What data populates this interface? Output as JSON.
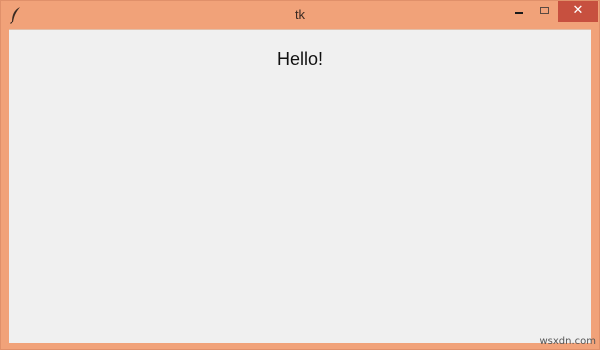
{
  "window": {
    "title": "tk",
    "frame_color": "#f1a279",
    "close_color": "#c7503f",
    "app_icon": "feather-icon",
    "controls": {
      "minimize_icon": "minimize-icon",
      "maximize_icon": "maximize-icon",
      "close_icon": "close-icon",
      "close_glyph": "✕"
    }
  },
  "content": {
    "label": "Hello!",
    "background": "#f0f0f0"
  },
  "watermark": "wsxdn.com"
}
